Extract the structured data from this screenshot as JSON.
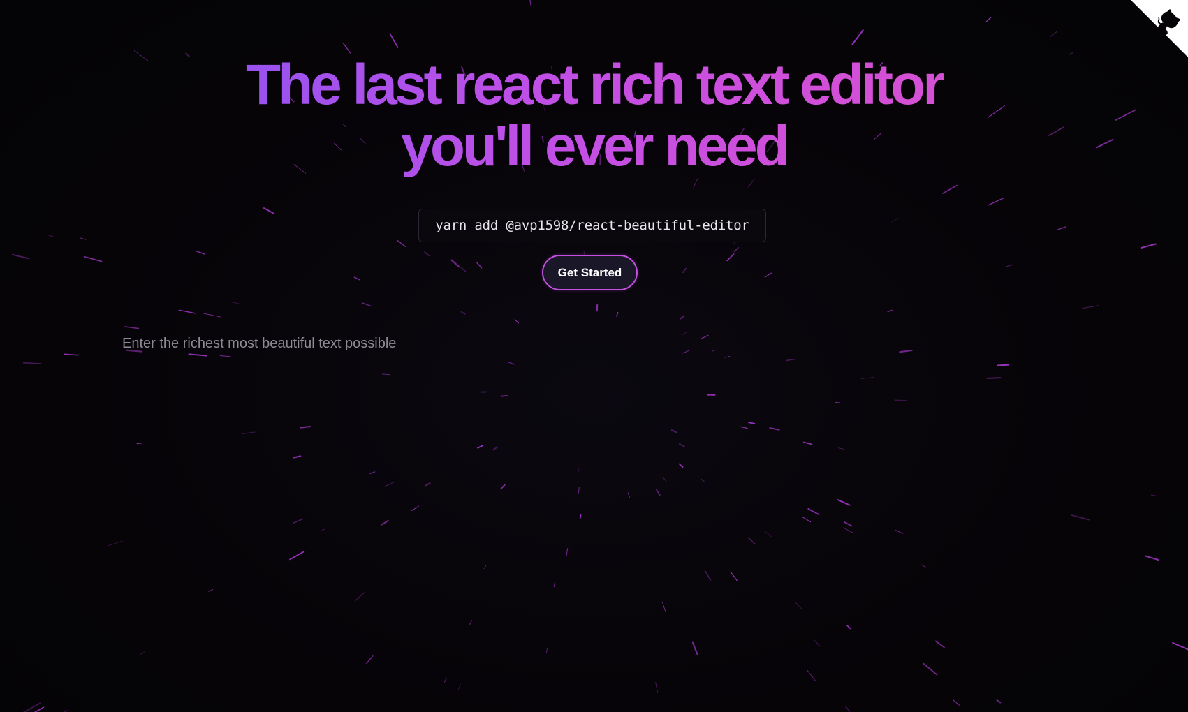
{
  "hero": {
    "headline_line1": "The last react rich text editor",
    "headline_line2": "you'll ever need"
  },
  "install": {
    "command": "yarn add @avp1598/react-beautiful-editor"
  },
  "cta": {
    "label": "Get Started"
  },
  "editor": {
    "placeholder": "Enter the richest most beautiful text possible"
  },
  "corner": {
    "icon": "github-octocat-icon"
  },
  "colors": {
    "background": "#060407",
    "gradient_start": "#6e5ff0",
    "gradient_end": "#d954c8",
    "button_border": "#c44fe0",
    "button_bg": "#191728",
    "star_color": "#b53be0"
  }
}
